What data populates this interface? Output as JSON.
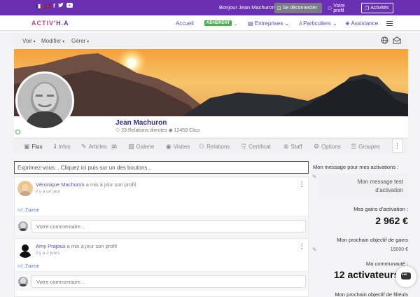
{
  "colors": {
    "accent": "#6b2fb3",
    "link": "#5a4bb0",
    "badge": "#4caf50",
    "logo_pink": "#d93a6f"
  },
  "topbar": {
    "social_icons": [
      "flag-fr-icon",
      "flag-uk-icon",
      "facebook-icon",
      "twitter-icon",
      "youtube-icon"
    ],
    "greeting": "Bonjour Jean Machuron",
    "logout_label": "Se déconnecter",
    "profile_label": "Votre profil",
    "activities_label": "Activités"
  },
  "navbar": {
    "logo_left": "ACTIV",
    "logo_right": "'H.A",
    "home": "Accueil",
    "badge": "ADHERENT",
    "companies": "Entreprises",
    "individuals": "Particuliers",
    "assistance": "Assistance"
  },
  "subbar": {
    "view": "Voir",
    "edit": "Modifier",
    "manage": "Gérer"
  },
  "profile": {
    "name": "Jean Machuron",
    "stats": "23 Relations directes",
    "clicks": "12459 Clics"
  },
  "tabs": [
    {
      "label": "Flux",
      "icon": "image-icon"
    },
    {
      "label": "Infos",
      "icon": "info-icon"
    },
    {
      "label": "Articles",
      "icon": "pencil-icon",
      "count": "10"
    },
    {
      "label": "Galerie",
      "icon": "gallery-icon"
    },
    {
      "label": "Visites",
      "icon": "eye-icon"
    },
    {
      "label": "Relations",
      "icon": "users-icon"
    },
    {
      "label": "Certificat",
      "icon": "certificate-icon"
    },
    {
      "label": "Staff",
      "icon": "steering-icon"
    },
    {
      "label": "Options",
      "icon": "gear-icon"
    },
    {
      "label": "Groupes",
      "icon": "chat-icon"
    }
  ],
  "feed": {
    "compose_placeholder": "Exprimez-vous... Cliquez ici puis sur un des boutons...",
    "posts": [
      {
        "author": "Véronique Machuron",
        "action": "a mis à jour son profil",
        "time": "il y a un jour",
        "like": "J'aime",
        "comment_placeholder": "Votre commentaire..."
      },
      {
        "author": "Amy Prajoux",
        "action": "a mis à jour son profil",
        "time": "il y a 2 jours",
        "like": "J'aime",
        "comment_placeholder": "Votre commentaire..."
      }
    ]
  },
  "sidebar": {
    "msg_title": "Mon message pour mes activations :",
    "msg_text_1": "Mon message test",
    "msg_text_2": "d'activation",
    "gains_label": "Mes gains d'activation :",
    "gains_value": "2 962 €",
    "next_goal_label": "Mon prochain objectif de gains",
    "next_goal_value": "15000 €",
    "community_label": "Ma communauté :",
    "community_value": "12 activateurs",
    "next_referral_label": "Mon prochain objectif de filleuls"
  }
}
